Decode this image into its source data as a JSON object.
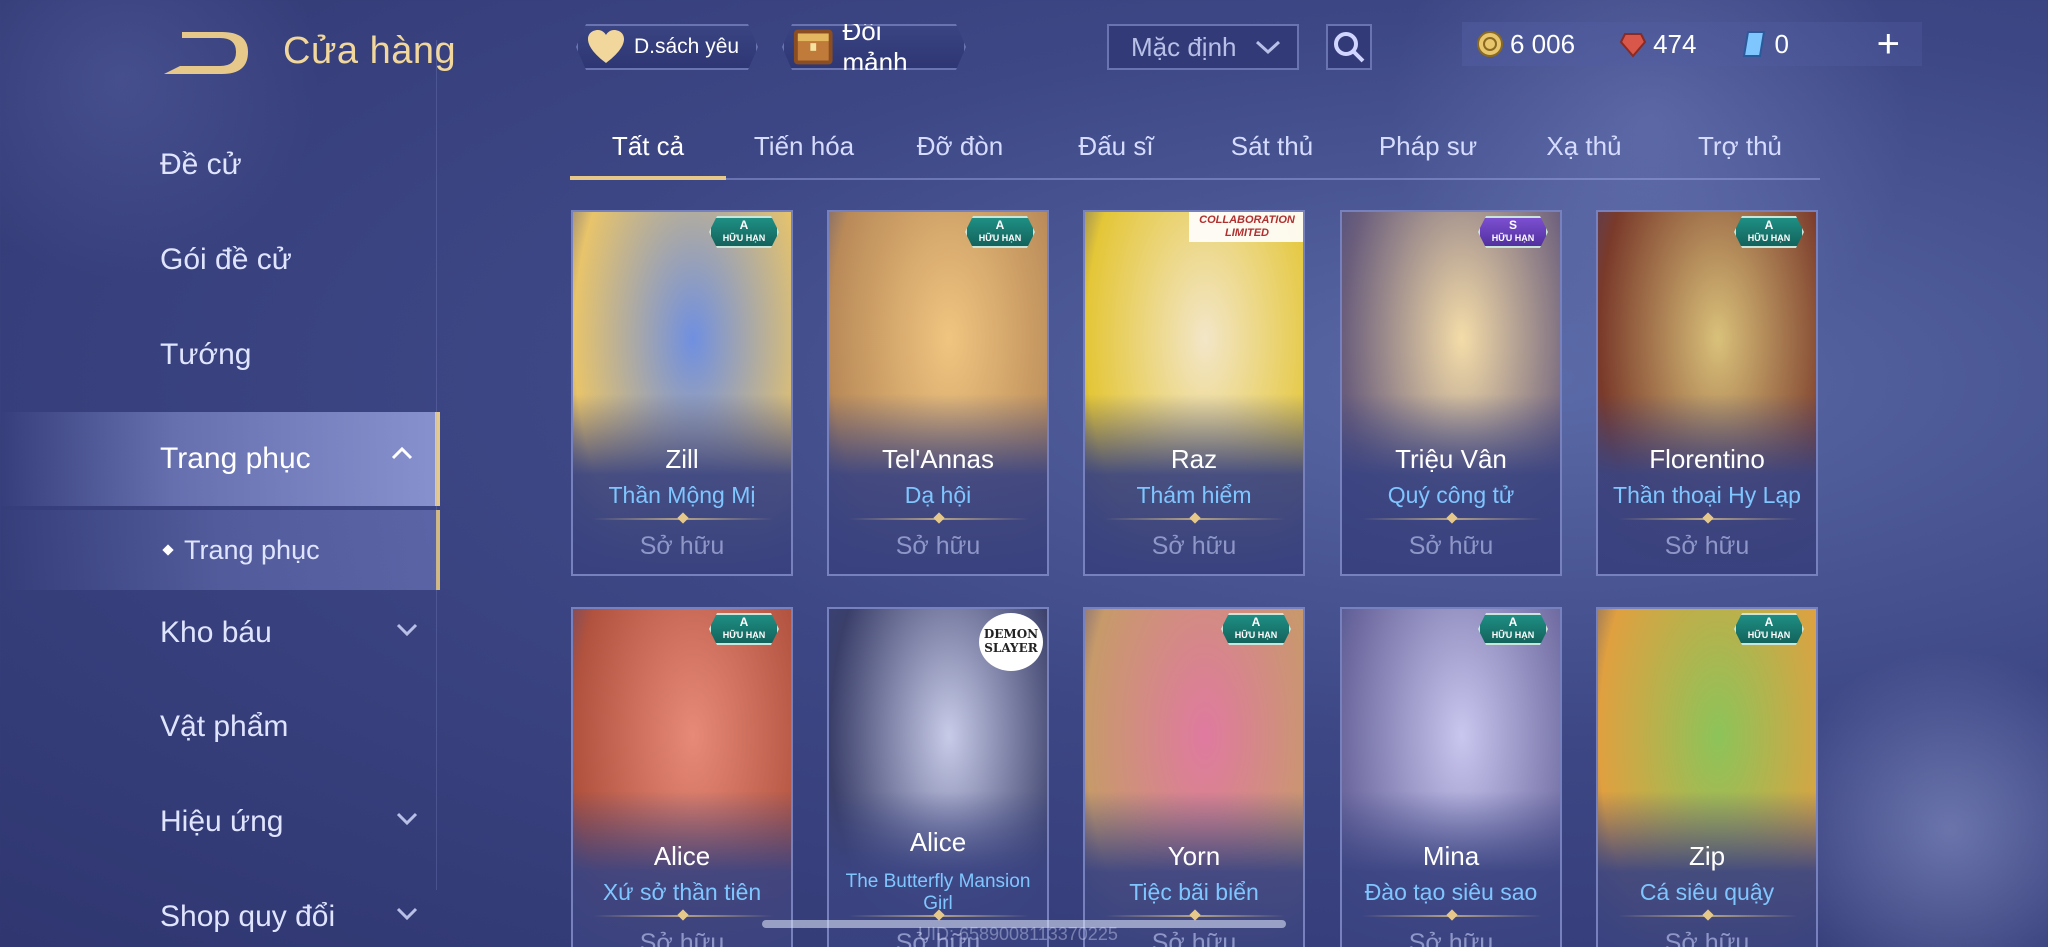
{
  "header": {
    "title": "Cửa hàng",
    "favorites_label": "D.sách yêu",
    "shard_exchange_label": "Đổi mảnh",
    "sort_value": "Mặc định",
    "currencies": [
      {
        "name": "gold",
        "value": "6 006",
        "color": "#e7c66e"
      },
      {
        "name": "vouchers",
        "value": "474",
        "color": "#d8564a"
      },
      {
        "name": "quan-huy",
        "value": "0",
        "color": "#7fc6ff"
      }
    ],
    "plus_label": "+"
  },
  "sidebar": {
    "items": [
      {
        "label": "Đề cử"
      },
      {
        "label": "Gói đề cử"
      },
      {
        "label": "Tướng"
      },
      {
        "label": "Trang phục"
      },
      {
        "label": "Trang phục"
      },
      {
        "label": "Kho báu"
      },
      {
        "label": "Vật phẩm"
      },
      {
        "label": "Hiệu ứng"
      },
      {
        "label": "Shop quy đổi"
      }
    ]
  },
  "tabs": [
    {
      "label": "Tất cả"
    },
    {
      "label": "Tiến hóa"
    },
    {
      "label": "Đỡ đòn"
    },
    {
      "label": "Đấu sĩ"
    },
    {
      "label": "Sát thủ"
    },
    {
      "label": "Pháp sư"
    },
    {
      "label": "Xạ thủ"
    },
    {
      "label": "Trợ thủ"
    }
  ],
  "cards": [
    {
      "hero": "Zill",
      "skin": "Thần Mộng Mị",
      "status": "Sở hữu",
      "badge_grade": "A",
      "badge_text": "HỮU HẠN",
      "art_a": "#6f8fe0",
      "art_b": "#e8c46a"
    },
    {
      "hero": "Tel'Annas",
      "skin": "Dạ hội",
      "status": "Sở hữu",
      "badge_grade": "A",
      "badge_text": "HỮU HẠN",
      "art_a": "#f0c580",
      "art_b": "#b98a58"
    },
    {
      "hero": "Raz",
      "skin": "Thám hiểm",
      "status": "Sở hữu",
      "collab_line1": "COLLABORATION",
      "collab_line2": "LIMITED",
      "art_a": "#f3e6c8",
      "art_b": "#e4c637"
    },
    {
      "hero": "Triệu Vân",
      "skin": "Quý công tử",
      "status": "Sở hữu",
      "badge_grade": "S",
      "badge_text": "HỮU HẠN",
      "art_a": "#f4dca8",
      "art_b": "#6b5e7c"
    },
    {
      "hero": "Florentino",
      "skin": "Thần thoại Hy Lạp",
      "status": "Sở hữu",
      "badge_grade": "A",
      "badge_text": "HỮU HẠN",
      "art_a": "#d9c17a",
      "art_b": "#7a3a2a"
    },
    {
      "hero": "Alice",
      "skin": "Xứ sở thần tiên",
      "status": "Sở hữu",
      "badge_grade": "A",
      "badge_text": "HỮU HẠN",
      "art_a": "#e88a78",
      "art_b": "#b0523e"
    },
    {
      "hero": "Alice",
      "skin": "The Butterfly Mansion Girl",
      "status": "Sở hữu",
      "demon_line1": "DEMON",
      "demon_line2": "SLAYER",
      "art_a": "#c8cbe8",
      "art_b": "#3a3f6a"
    },
    {
      "hero": "Yorn",
      "skin": "Tiệc bãi biển",
      "status": "Sở hữu",
      "badge_grade": "A",
      "badge_text": "HỮU HẠN",
      "art_a": "#e07aa0",
      "art_b": "#c79a6a"
    },
    {
      "hero": "Mina",
      "skin": "Đào tạo siêu sao",
      "status": "Sở hữu",
      "badge_grade": "A",
      "badge_text": "HỮU HẠN",
      "art_a": "#c9c6ef",
      "art_b": "#6e6aa0"
    },
    {
      "hero": "Zip",
      "skin": "Cá siêu quậy",
      "status": "Sở hữu",
      "badge_grade": "A",
      "badge_text": "HỮU HẠN",
      "art_a": "#8cc45a",
      "art_b": "#e0a040"
    }
  ],
  "footer": {
    "uid": "UID: 6589008113370225"
  },
  "colors": {
    "accent_gold": "#e6c98a",
    "skin_name": "#7fc6ff",
    "background": "#3d4785"
  }
}
